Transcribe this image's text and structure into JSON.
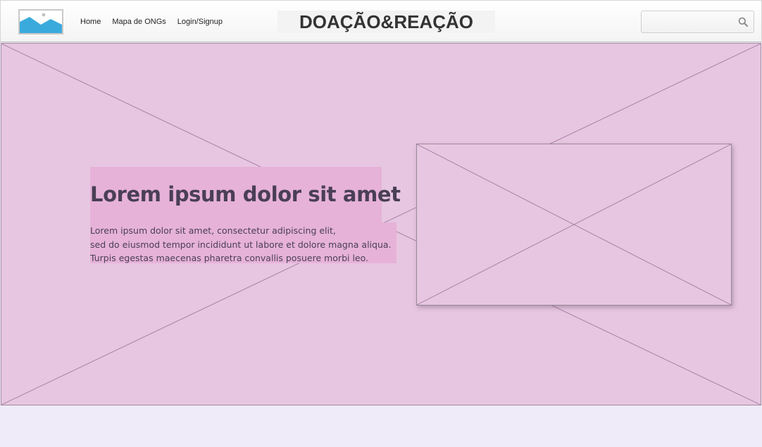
{
  "header": {
    "logo_icon": "image-placeholder-icon",
    "nav": [
      {
        "label": "Home"
      },
      {
        "label": "Mapa de ONGs"
      },
      {
        "label": "Login/Signup"
      }
    ],
    "brand": "DOAÇÃO&REAÇÃO",
    "search": {
      "value": "",
      "placeholder": "",
      "icon": "search-icon"
    }
  },
  "hero": {
    "background_icon": "image-placeholder-icon",
    "title": "Lorem ipsum dolor sit amet",
    "body_lines": [
      "Lorem ipsum dolor sit amet, consectetur adipiscing elit,",
      "sed do eiusmod tempor incididunt ut labore et dolore magna aliqua.",
      "Turpis egestas maecenas pharetra convallis posuere morbi leo."
    ],
    "media_icon": "image-placeholder-icon"
  },
  "colors": {
    "hero_bg": "#e7c6e1",
    "highlight": "#e6b2d8",
    "text": "#4a3f55",
    "footer_bg": "#efebf9",
    "logo_blue": "#3aaadc"
  }
}
